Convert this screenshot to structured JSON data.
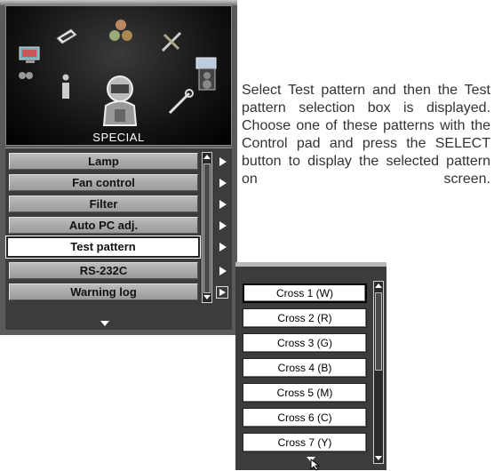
{
  "osd": {
    "section_title": "SPECIAL",
    "header_icons": [
      "monitor-icon",
      "lcd-panel-icon",
      "color-balls-icon",
      "tools-icon",
      "speaker-icon",
      "info-icon",
      "person-icon",
      "wrench-icon"
    ],
    "menu_items": [
      {
        "label": "Lamp"
      },
      {
        "label": "Fan control"
      },
      {
        "label": "Filter"
      },
      {
        "label": "Auto PC adj."
      },
      {
        "label": "Test pattern",
        "selected": true
      },
      {
        "label": "RS-232C"
      },
      {
        "label": "Warning log"
      }
    ]
  },
  "pattern_popup": {
    "items": [
      {
        "label": "Cross 1 (W)",
        "selected": true
      },
      {
        "label": "Cross 2 (R)"
      },
      {
        "label": "Cross 3 (G)"
      },
      {
        "label": "Cross 4 (B)"
      },
      {
        "label": "Cross 5 (M)"
      },
      {
        "label": "Cross 6 (C)"
      },
      {
        "label": "Cross 7 (Y)"
      }
    ]
  },
  "description": "Select Test pattern and then the Test pattern selection box is displayed. Choose one of these patterns with the Control pad and press the SELECT button to display the selected pattern on screen.",
  "colors": {
    "menu_bg": "#3c3c3c",
    "item_bg": "#aaaaaa",
    "highlight": "#ffffff",
    "text": "#333333"
  }
}
